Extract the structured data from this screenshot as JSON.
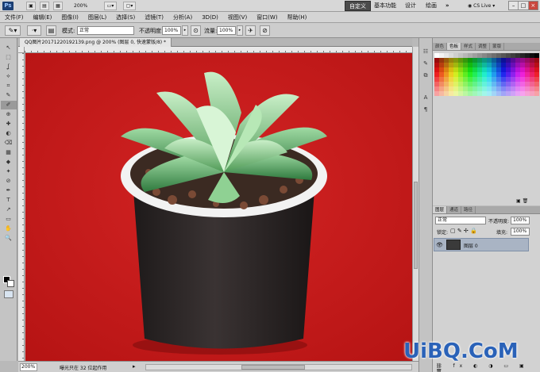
{
  "app": {
    "logo": "Ps",
    "zoom": "200%"
  },
  "workspaces": [
    {
      "label": "自定义",
      "active": true
    },
    {
      "label": "基本功能",
      "active": false
    },
    {
      "label": "设计",
      "active": false
    },
    {
      "label": "绘画",
      "active": false
    }
  ],
  "more_glyph": "»",
  "cs_live": "CS Live",
  "window_controls": [
    "–",
    "□",
    "×"
  ],
  "menu": [
    "文件(F)",
    "编辑(E)",
    "图像(I)",
    "图层(L)",
    "选择(S)",
    "滤镜(T)",
    "分析(A)",
    "3D(D)",
    "视图(V)",
    "窗口(W)",
    "帮助(H)"
  ],
  "options": {
    "mode_label": "模式:",
    "mode_value": "正常",
    "opacity_label": "不透明度:",
    "opacity_value": "100%",
    "flow_label": "流量:",
    "flow_value": "100%"
  },
  "document": {
    "tab_title": "QQ图片20171220192139.png @ 200% (图层 0, 快速蒙版/8) *",
    "status_zoom": "200%",
    "status_info": "曝光只在 32 位起作用"
  },
  "tools": [
    "↖",
    "⬚",
    "ʆ",
    "⟡",
    "⌗",
    "✎",
    "✐",
    "⊕",
    "✚",
    "◐",
    "⌫",
    "▦",
    "◆",
    "✦",
    "⊘",
    "✒",
    "T",
    "↗",
    "▭",
    "✋",
    "🔍"
  ],
  "swatch_panel": {
    "tabs": [
      "颜色",
      "色板",
      "样式"
    ],
    "extra_tabs": [
      "调整",
      "蒙版"
    ]
  },
  "layers_panel": {
    "tabs": [
      "图层",
      "通道",
      "路径"
    ],
    "blend_mode": "正常",
    "opacity_label": "不透明度:",
    "opacity_value": "100%",
    "lock_label": "锁定:",
    "fill_label": "填充:",
    "fill_value": "100%",
    "layers": [
      {
        "name": "图层 0",
        "visible": true
      }
    ]
  },
  "watermark": "UiBQ.CoM",
  "colors": {
    "canvas_red": "#c81c1c",
    "pot": "#2a2424",
    "accent_blue": "#2a62b8"
  }
}
